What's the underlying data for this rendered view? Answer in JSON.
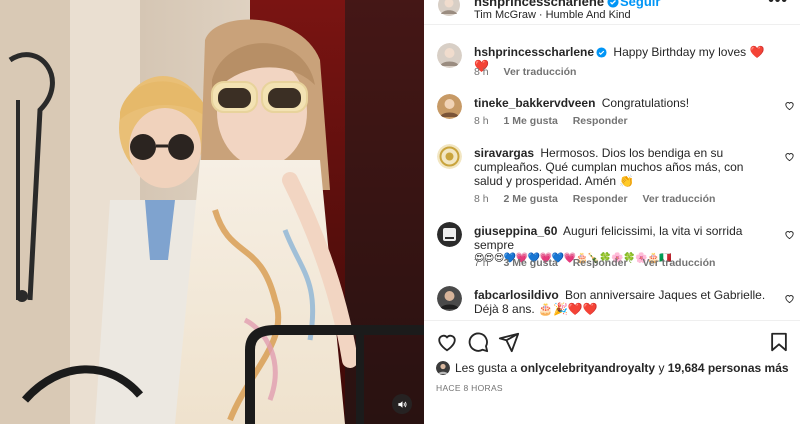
{
  "post": {
    "username": "hshprincesscharlene",
    "follow_label": "Seguir",
    "music_artist": "Tim McGraw",
    "music_song": "Humble And Kind",
    "more_label": "•••",
    "caption": "Happy Birthday my loves",
    "caption_emoji": "❤️❤️",
    "caption_time": "8 h",
    "see_translation": "Ver traducción"
  },
  "comments": [
    {
      "user": "tineke_bakkervdveen",
      "text": "Congratulations!",
      "time": "8 h",
      "likes": "1 Me gusta",
      "reply": "Responder",
      "translate": ""
    },
    {
      "user": "siravargas",
      "text": "Hermosos. Dios los bendiga en su cumpleaños. Qué cumplan muchos años más, con salud y prosperidad. Amén 👏",
      "time": "8 h",
      "likes": "2 Me gusta",
      "reply": "Responder",
      "translate": "Ver traducción"
    },
    {
      "user": "giuseppina_60",
      "text": "Auguri felicissimi, la vita vi sorrida sempre",
      "emoji_line": "😍😍😍💙💗💙💗💙💗🎂🍾🍀🌸🍀🌸🎂🇮🇹",
      "time": "7 h",
      "likes": "3 Me gusta",
      "reply": "Responder",
      "translate": "Ver traducción"
    },
    {
      "user": "fabcarlosildivo",
      "text": "Bon anniversaire Jaques et Gabrielle. Déjà 8 ans. 🎂🎉❤️❤️",
      "time": "",
      "likes": "",
      "reply": "",
      "translate": ""
    }
  ],
  "likes": {
    "prefix": "Les gusta a",
    "first_user": "onlycelebrityandroyalty",
    "joiner": "y",
    "count_text": "19,684 personas más"
  },
  "posted_ago": "HACE 8 HORAS",
  "icons": {
    "like": "heart-icon",
    "comment": "comment-icon",
    "share": "paper-plane-icon",
    "save": "bookmark-icon",
    "verified": "verified-badge-icon",
    "mute": "sound-icon"
  },
  "colors": {
    "link_blue": "#0095f6",
    "verified_blue": "#0095f6",
    "heart_red": "#ed4956",
    "muted_text": "#737373"
  }
}
